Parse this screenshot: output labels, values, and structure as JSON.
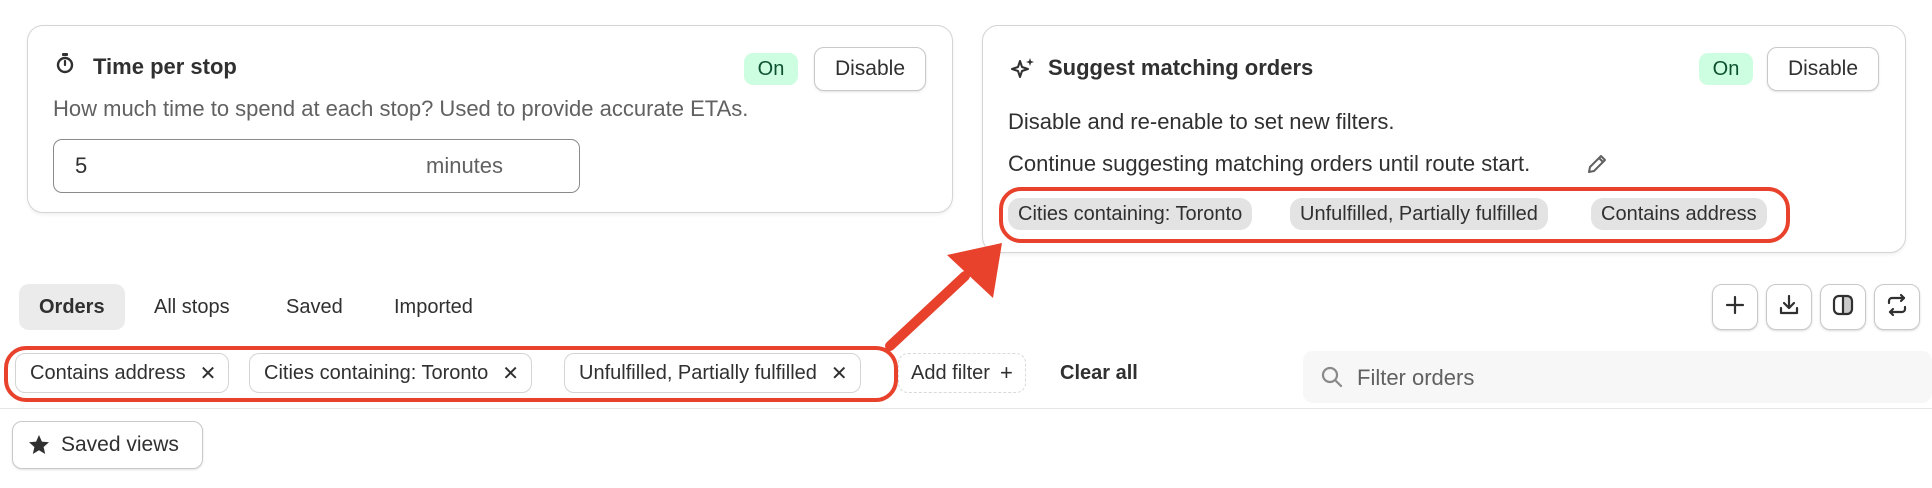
{
  "time_card": {
    "title": "Time per stop",
    "status": "On",
    "disable_label": "Disable",
    "description": "How much time to spend at each stop? Used to provide accurate ETAs.",
    "input_value": "5",
    "unit": "minutes"
  },
  "suggest_card": {
    "title": "Suggest matching orders",
    "status": "On",
    "disable_label": "Disable",
    "line1": "Disable and re-enable to set new filters.",
    "line2": "Continue suggesting matching orders until route start.",
    "chips": [
      "Cities containing: Toronto",
      "Unfulfilled, Partially fulfilled",
      "Contains address"
    ]
  },
  "tabs": [
    "Orders",
    "All stops",
    "Saved",
    "Imported"
  ],
  "toolbar_icons": [
    "plus-icon",
    "download-icon",
    "columns-icon",
    "sync-icon"
  ],
  "filters": {
    "applied": [
      "Contains address",
      "Cities containing: Toronto",
      "Unfulfilled, Partially fulfilled"
    ],
    "add_filter_label": "Add filter",
    "clear_all_label": "Clear all",
    "search_placeholder": "Filter orders"
  },
  "saved_views_label": "Saved views",
  "colors": {
    "annotation": "#e8412c",
    "badge_on_bg": "#cdfee1",
    "badge_on_text": "#0c5132"
  }
}
